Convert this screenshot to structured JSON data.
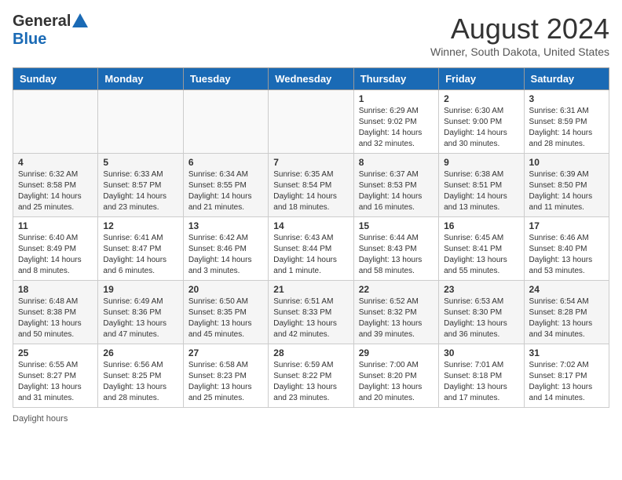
{
  "header": {
    "logo_general": "General",
    "logo_blue": "Blue",
    "month_year": "August 2024",
    "location": "Winner, South Dakota, United States"
  },
  "days_of_week": [
    "Sunday",
    "Monday",
    "Tuesday",
    "Wednesday",
    "Thursday",
    "Friday",
    "Saturday"
  ],
  "weeks": [
    [
      {
        "day": "",
        "info": ""
      },
      {
        "day": "",
        "info": ""
      },
      {
        "day": "",
        "info": ""
      },
      {
        "day": "",
        "info": ""
      },
      {
        "day": "1",
        "info": "Sunrise: 6:29 AM\nSunset: 9:02 PM\nDaylight: 14 hours and 32 minutes."
      },
      {
        "day": "2",
        "info": "Sunrise: 6:30 AM\nSunset: 9:00 PM\nDaylight: 14 hours and 30 minutes."
      },
      {
        "day": "3",
        "info": "Sunrise: 6:31 AM\nSunset: 8:59 PM\nDaylight: 14 hours and 28 minutes."
      }
    ],
    [
      {
        "day": "4",
        "info": "Sunrise: 6:32 AM\nSunset: 8:58 PM\nDaylight: 14 hours and 25 minutes."
      },
      {
        "day": "5",
        "info": "Sunrise: 6:33 AM\nSunset: 8:57 PM\nDaylight: 14 hours and 23 minutes."
      },
      {
        "day": "6",
        "info": "Sunrise: 6:34 AM\nSunset: 8:55 PM\nDaylight: 14 hours and 21 minutes."
      },
      {
        "day": "7",
        "info": "Sunrise: 6:35 AM\nSunset: 8:54 PM\nDaylight: 14 hours and 18 minutes."
      },
      {
        "day": "8",
        "info": "Sunrise: 6:37 AM\nSunset: 8:53 PM\nDaylight: 14 hours and 16 minutes."
      },
      {
        "day": "9",
        "info": "Sunrise: 6:38 AM\nSunset: 8:51 PM\nDaylight: 14 hours and 13 minutes."
      },
      {
        "day": "10",
        "info": "Sunrise: 6:39 AM\nSunset: 8:50 PM\nDaylight: 14 hours and 11 minutes."
      }
    ],
    [
      {
        "day": "11",
        "info": "Sunrise: 6:40 AM\nSunset: 8:49 PM\nDaylight: 14 hours and 8 minutes."
      },
      {
        "day": "12",
        "info": "Sunrise: 6:41 AM\nSunset: 8:47 PM\nDaylight: 14 hours and 6 minutes."
      },
      {
        "day": "13",
        "info": "Sunrise: 6:42 AM\nSunset: 8:46 PM\nDaylight: 14 hours and 3 minutes."
      },
      {
        "day": "14",
        "info": "Sunrise: 6:43 AM\nSunset: 8:44 PM\nDaylight: 14 hours and 1 minute."
      },
      {
        "day": "15",
        "info": "Sunrise: 6:44 AM\nSunset: 8:43 PM\nDaylight: 13 hours and 58 minutes."
      },
      {
        "day": "16",
        "info": "Sunrise: 6:45 AM\nSunset: 8:41 PM\nDaylight: 13 hours and 55 minutes."
      },
      {
        "day": "17",
        "info": "Sunrise: 6:46 AM\nSunset: 8:40 PM\nDaylight: 13 hours and 53 minutes."
      }
    ],
    [
      {
        "day": "18",
        "info": "Sunrise: 6:48 AM\nSunset: 8:38 PM\nDaylight: 13 hours and 50 minutes."
      },
      {
        "day": "19",
        "info": "Sunrise: 6:49 AM\nSunset: 8:36 PM\nDaylight: 13 hours and 47 minutes."
      },
      {
        "day": "20",
        "info": "Sunrise: 6:50 AM\nSunset: 8:35 PM\nDaylight: 13 hours and 45 minutes."
      },
      {
        "day": "21",
        "info": "Sunrise: 6:51 AM\nSunset: 8:33 PM\nDaylight: 13 hours and 42 minutes."
      },
      {
        "day": "22",
        "info": "Sunrise: 6:52 AM\nSunset: 8:32 PM\nDaylight: 13 hours and 39 minutes."
      },
      {
        "day": "23",
        "info": "Sunrise: 6:53 AM\nSunset: 8:30 PM\nDaylight: 13 hours and 36 minutes."
      },
      {
        "day": "24",
        "info": "Sunrise: 6:54 AM\nSunset: 8:28 PM\nDaylight: 13 hours and 34 minutes."
      }
    ],
    [
      {
        "day": "25",
        "info": "Sunrise: 6:55 AM\nSunset: 8:27 PM\nDaylight: 13 hours and 31 minutes."
      },
      {
        "day": "26",
        "info": "Sunrise: 6:56 AM\nSunset: 8:25 PM\nDaylight: 13 hours and 28 minutes."
      },
      {
        "day": "27",
        "info": "Sunrise: 6:58 AM\nSunset: 8:23 PM\nDaylight: 13 hours and 25 minutes."
      },
      {
        "day": "28",
        "info": "Sunrise: 6:59 AM\nSunset: 8:22 PM\nDaylight: 13 hours and 23 minutes."
      },
      {
        "day": "29",
        "info": "Sunrise: 7:00 AM\nSunset: 8:20 PM\nDaylight: 13 hours and 20 minutes."
      },
      {
        "day": "30",
        "info": "Sunrise: 7:01 AM\nSunset: 8:18 PM\nDaylight: 13 hours and 17 minutes."
      },
      {
        "day": "31",
        "info": "Sunrise: 7:02 AM\nSunset: 8:17 PM\nDaylight: 13 hours and 14 minutes."
      }
    ]
  ],
  "footer": {
    "daylight_hours": "Daylight hours"
  }
}
